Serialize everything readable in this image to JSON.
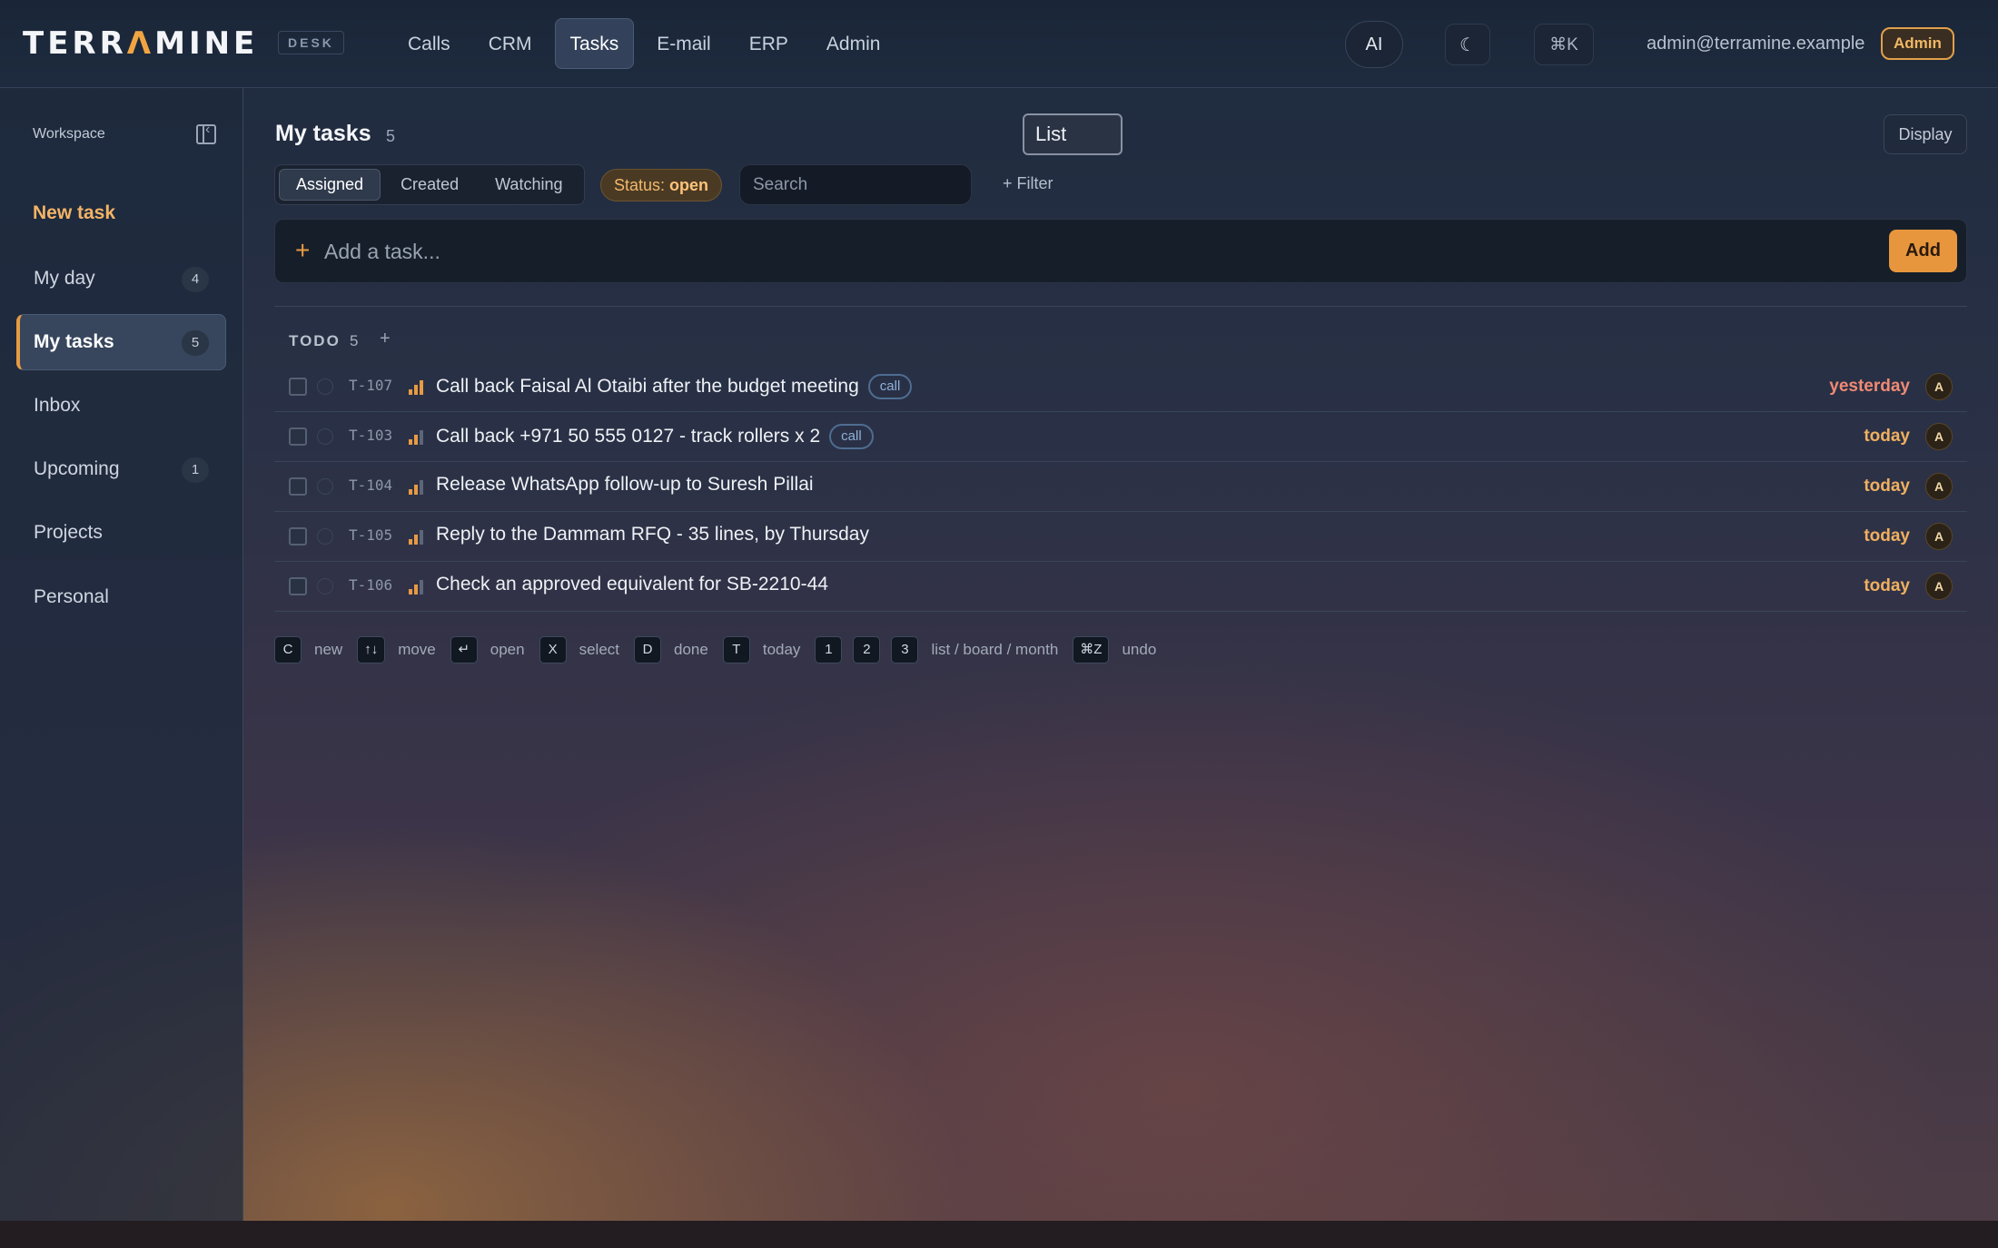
{
  "app": {
    "logo_pre": "TERR",
    "logo_accent": "Λ",
    "logo_post": "MINE",
    "tag": "DESK"
  },
  "nav": {
    "items": [
      "Calls",
      "CRM",
      "Tasks",
      "E-mail",
      "ERP",
      "Admin"
    ],
    "active": "Tasks"
  },
  "header_actions": {
    "ai": "AI",
    "theme_icon": "moon-icon",
    "theme_glyph": "☾",
    "cmdk": "⌘K",
    "user_email": "admin@terramine.example",
    "role": "Admin"
  },
  "sidebar": {
    "workspace": "Workspace",
    "new_task": "New task",
    "items": [
      {
        "label": "My day",
        "count": "4"
      },
      {
        "label": "My tasks",
        "count": "5"
      },
      {
        "label": "Inbox",
        "count": ""
      },
      {
        "label": "Upcoming",
        "count": "1"
      },
      {
        "label": "Projects",
        "count": ""
      },
      {
        "label": "Personal",
        "count": ""
      }
    ],
    "active": "My tasks"
  },
  "main": {
    "title": "My tasks",
    "count": "5",
    "view": "List",
    "display": "Display",
    "segments": [
      "Assigned",
      "Created",
      "Watching"
    ],
    "active_segment": "Assigned",
    "status_label": "Status:",
    "status_value": "open",
    "search_placeholder": "Search",
    "filter": "+ Filter",
    "add_placeholder": "Add a task...",
    "add_button": "Add"
  },
  "group": {
    "title": "TODO",
    "count": "5",
    "add": "+"
  },
  "tasks": [
    {
      "id": "T-107",
      "priority": "high",
      "title": "Call back Faisal Al Otaibi after the budget meeting",
      "tag": "call",
      "due": "yesterday",
      "assignee": "A"
    },
    {
      "id": "T-103",
      "priority": "medium",
      "title": "Call back +971 50 555 0127 - track rollers x 2",
      "tag": "call",
      "due": "today",
      "assignee": "A"
    },
    {
      "id": "T-104",
      "priority": "medium",
      "title": "Release WhatsApp follow-up to Suresh Pillai",
      "tag": "",
      "due": "today",
      "assignee": "A"
    },
    {
      "id": "T-105",
      "priority": "medium",
      "title": "Reply to the Dammam RFQ - 35 lines, by Thursday",
      "tag": "",
      "due": "today",
      "assignee": "A"
    },
    {
      "id": "T-106",
      "priority": "medium",
      "title": "Check an approved equivalent for SB-2210-44",
      "tag": "",
      "due": "today",
      "assignee": "A"
    }
  ],
  "shortcuts": [
    {
      "key": "C",
      "label": "new"
    },
    {
      "key": "↑↓",
      "label": "move"
    },
    {
      "key": "↵",
      "label": "open"
    },
    {
      "key": "X",
      "label": "select"
    },
    {
      "key": "D",
      "label": "done"
    },
    {
      "key": "T",
      "label": "today"
    },
    {
      "key": "1",
      "label": ""
    },
    {
      "key": "2",
      "label": ""
    },
    {
      "key": "3",
      "label": "list / board / month"
    },
    {
      "key": "⌘Z",
      "label": "undo"
    }
  ],
  "colors": {
    "accent": "#e8963d",
    "overdue": "#f08a74",
    "due_today": "#f0b060",
    "tag_border": "#4f6d92"
  }
}
